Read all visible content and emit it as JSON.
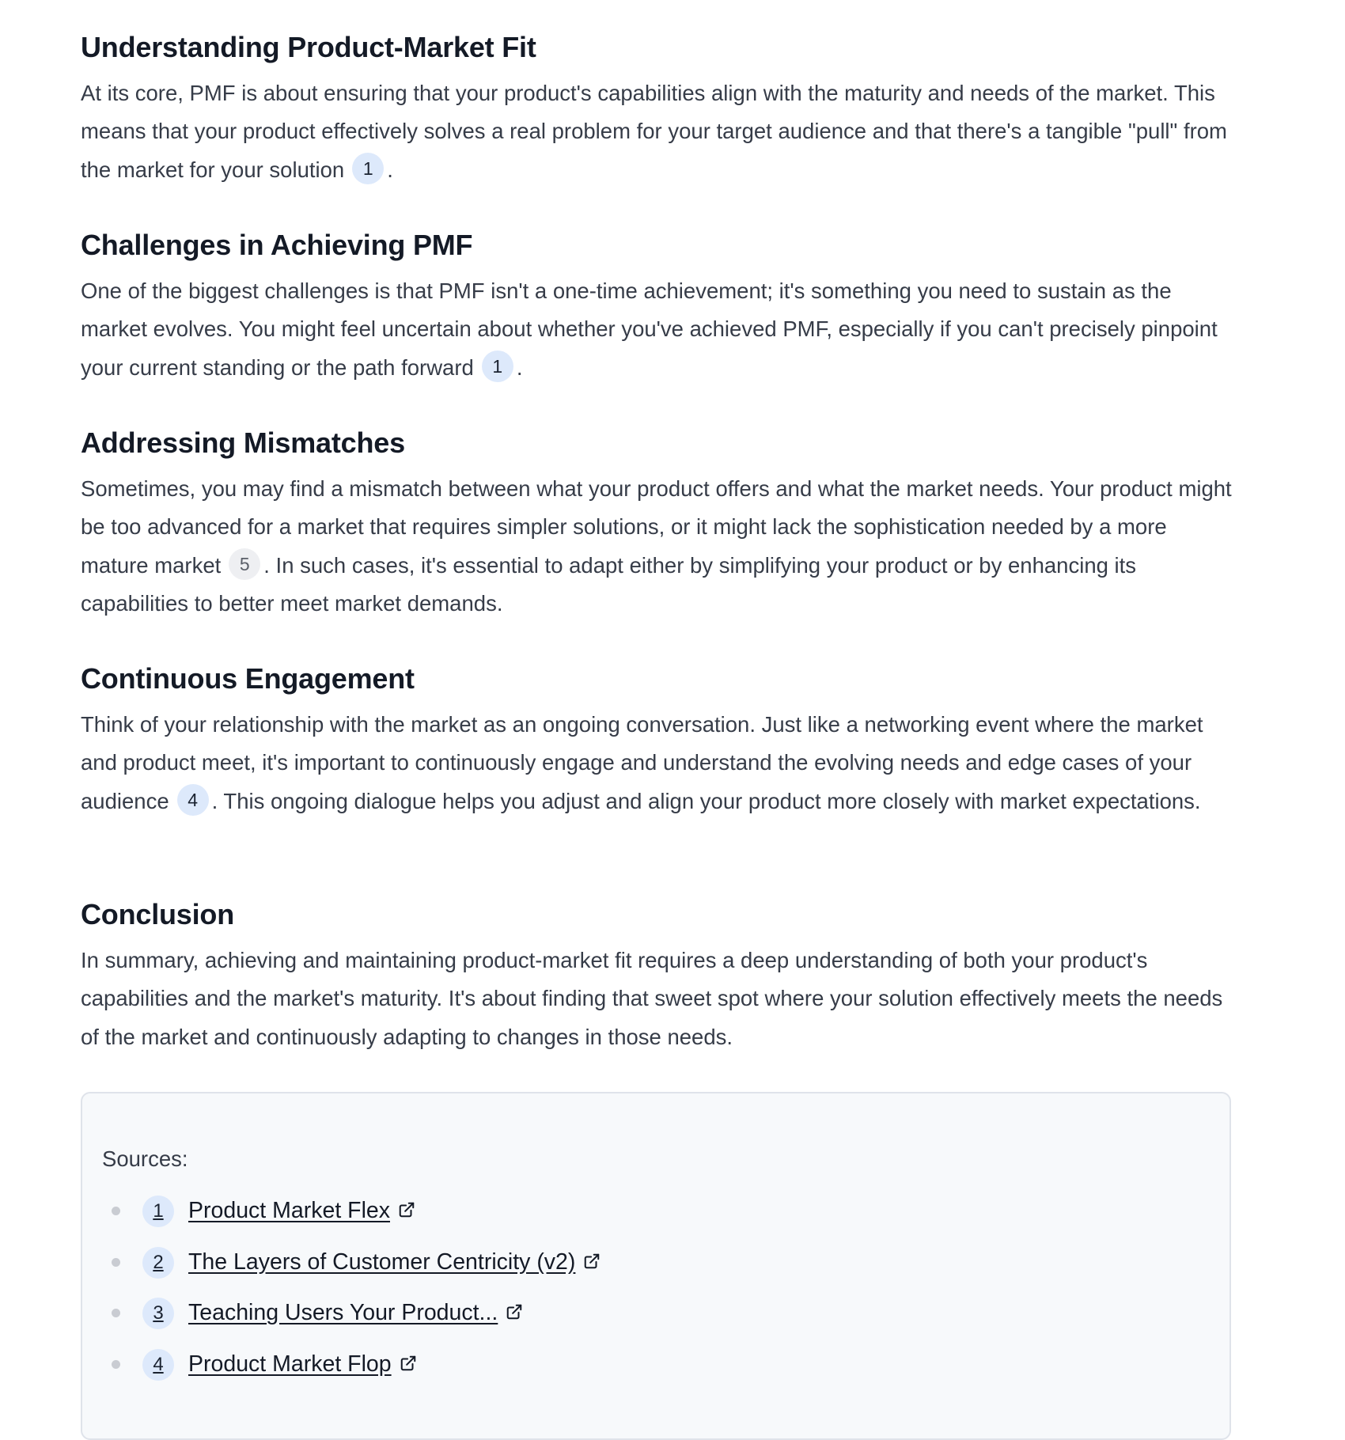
{
  "sections": [
    {
      "heading": "Understanding Product-Market Fit",
      "text_before": "At its core, PMF is about ensuring that your product's capabilities align with the maturity and needs of the market. This means that your product effectively solves a real problem for your target audience and that there's a tangible \"pull\" from the market for your solution",
      "citation": "1",
      "text_after": "."
    },
    {
      "heading": "Challenges in Achieving PMF",
      "text_before": "One of the biggest challenges is that PMF isn't a one-time achievement; it's something you need to sustain as the market evolves. You might feel uncertain about whether you've achieved PMF, especially if you can't precisely pinpoint your current standing or the path forward",
      "citation": "1",
      "text_after": "."
    },
    {
      "heading": "Addressing Mismatches",
      "text_before": "Sometimes, you may find a mismatch between what your product offers and what the market needs. Your product might be too advanced for a market that requires simpler solutions, or it might lack the sophistication needed by a more mature market",
      "citation": "5",
      "text_after": ". In such cases, it's essential to adapt either by simplifying your product or by enhancing its capabilities to better meet market demands."
    },
    {
      "heading": "Continuous Engagement",
      "text_before": "Think of your relationship with the market as an ongoing conversation. Just like a networking event where the market and product meet, it's important to continuously engage and understand the evolving needs and edge cases of your audience",
      "citation": "4",
      "text_after": ". This ongoing dialogue helps you adjust and align your product more closely with market expectations."
    },
    {
      "heading": "Conclusion",
      "text": "In summary, achieving and maintaining product-market fit requires a deep understanding of both your product's capabilities and the market's maturity. It's about finding that sweet spot where your solution effectively meets the needs of the market and continuously adapting to changes in those needs."
    }
  ],
  "sources": {
    "label": "Sources:",
    "items": [
      {
        "num": "1",
        "title": "Product Market Flex",
        "icon": "external-link-icon"
      },
      {
        "num": "2",
        "title": "The Layers of Customer Centricity (v2)",
        "icon": "external-link-icon"
      },
      {
        "num": "3",
        "title": "Teaching Users Your Product...",
        "icon": "external-link-icon"
      },
      {
        "num": "4",
        "title": "Product Market Flop",
        "icon": "external-link-icon"
      }
    ]
  },
  "colors": {
    "heading": "#141a26",
    "body_text": "#363c48",
    "citation_blue_bg": "#dde9fb",
    "citation_gray_bg": "#eeeff2",
    "sources_bg": "#f7f9fb",
    "sources_border": "#dfe3ea"
  }
}
